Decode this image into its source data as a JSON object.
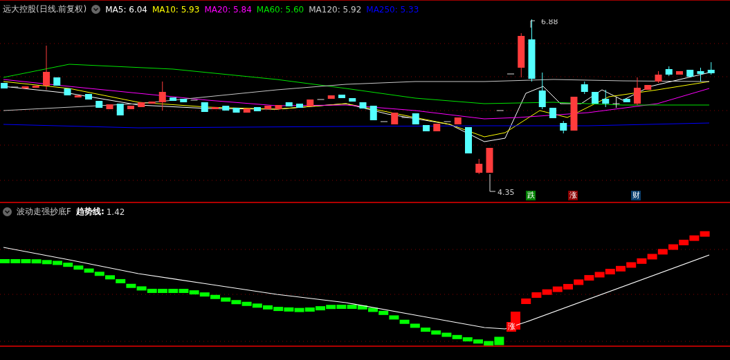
{
  "price_panel": {
    "title": "远大控股(日线.前复权)",
    "indicators": [
      {
        "label": "MA5:",
        "value": "6.04",
        "color": "#ffffff"
      },
      {
        "label": "MA10:",
        "value": "5.93",
        "color": "#ffff00"
      },
      {
        "label": "MA20:",
        "value": "5.84",
        "color": "#ff00ff"
      },
      {
        "label": "MA60:",
        "value": "5.60",
        "color": "#00e600"
      },
      {
        "label": "MA120:",
        "value": "5.92",
        "color": "#c8c8c8"
      },
      {
        "label": "MA250:",
        "value": "5.33",
        "color": "#0000ff"
      }
    ],
    "high_label": "6.88",
    "low_label": "4.35",
    "signals": [
      {
        "text": "跌",
        "color": "#008000"
      },
      {
        "text": "涨",
        "color": "#8b0000"
      },
      {
        "text": "财",
        "color": "#0b3f6e"
      }
    ]
  },
  "indicator_panel": {
    "title": "波动走强抄底F",
    "line_label": "趋势线:",
    "line_value": "1.42",
    "signal": {
      "text": "涨",
      "color": "#ff0000"
    }
  }
}
